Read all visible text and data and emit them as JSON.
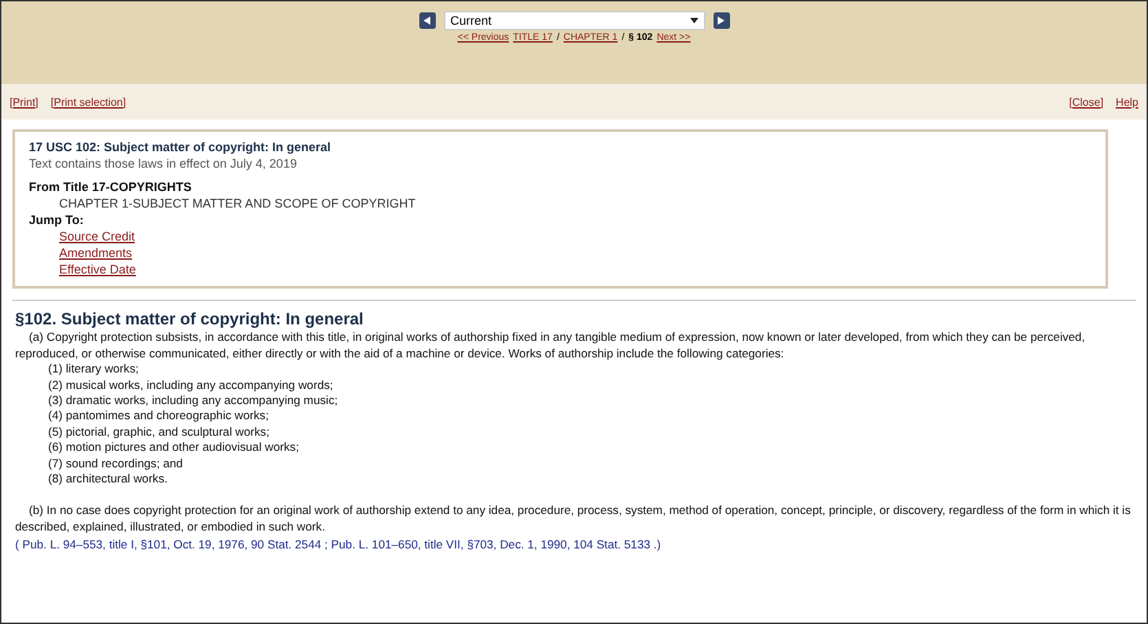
{
  "nav": {
    "select_value": "Current",
    "breadcrumb": [
      {
        "text": "<< Previous",
        "kind": "link"
      },
      {
        "text": "TITLE 17",
        "kind": "link"
      },
      {
        "text": "/",
        "kind": "sep"
      },
      {
        "text": "CHAPTER 1",
        "kind": "link"
      },
      {
        "text": "/",
        "kind": "sep"
      },
      {
        "text": "§ 102",
        "kind": "current"
      },
      {
        "text": "Next >>",
        "kind": "link"
      }
    ]
  },
  "toolbar": {
    "left": [
      "[Print]",
      "[Print selection]"
    ],
    "right": [
      "[Close]",
      "Help"
    ]
  },
  "summary": {
    "title": "17 USC 102: Subject matter of copyright: In general",
    "note": "Text contains those laws in effect on July 4, 2019",
    "from_label": "From Title 17-COPYRIGHTS",
    "chapter": "CHAPTER 1-SUBJECT MATTER AND SCOPE OF COPYRIGHT",
    "jump_label": "Jump To:",
    "jump_links": [
      "Source Credit",
      "Amendments",
      "Effective Date"
    ]
  },
  "section": {
    "heading": "§102. Subject matter of copyright: In general",
    "para_a": "(a) Copyright protection subsists, in accordance with this title, in original works of authorship fixed in any tangible medium of expression, now known or later developed, from which they can be perceived, reproduced, or otherwise communicated, either directly or with the aid of a machine or device. Works of authorship include the following categories:",
    "categories": [
      "(1) literary works;",
      "(2) musical works, including any accompanying words;",
      "(3) dramatic works, including any accompanying music;",
      "(4) pantomimes and choreographic works;",
      "(5) pictorial, graphic, and sculptural works;",
      "(6) motion pictures and other audiovisual works;",
      "(7) sound recordings; and",
      "(8) architectural works."
    ],
    "para_b": "(b) In no case does copyright protection for an original work of authorship extend to any idea, procedure, process, system, method of operation, concept, principle, or discovery, regardless of the form in which it is described, explained, illustrated, or embodied in such work.",
    "source_credit": "( Pub. L. 94–553, title I, §101, Oct. 19, 1976, 90 Stat. 2544 ; Pub. L. 101–650, title VII, §703, Dec. 1, 1990, 104 Stat. 5133 .)"
  }
}
